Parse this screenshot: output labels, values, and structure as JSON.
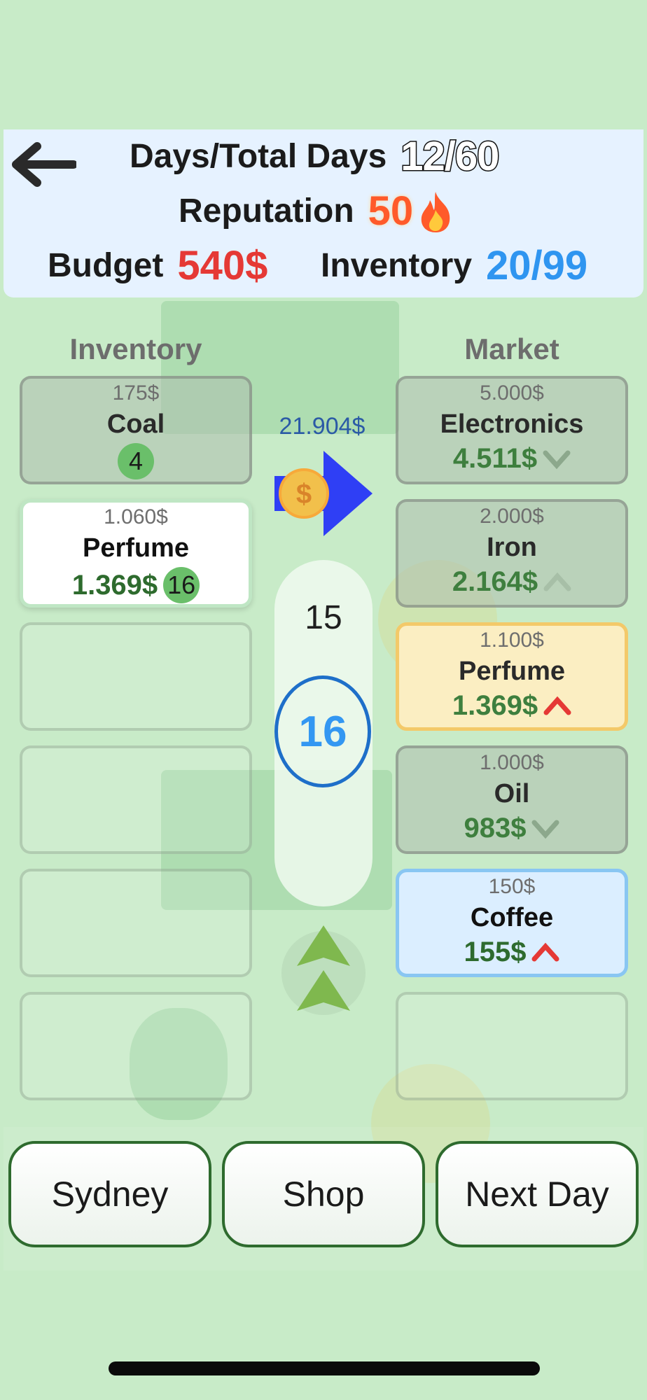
{
  "header": {
    "days_label": "Days/Total Days",
    "days_value": "12/60",
    "reputation_label": "Reputation",
    "reputation_value": "50",
    "reputation_icon": "fire-icon",
    "budget_label": "Budget",
    "budget_value": "540$",
    "inventory_label": "Inventory",
    "inventory_value": "20/99"
  },
  "inventory": {
    "title": "Inventory",
    "slots": [
      {
        "price": "175$",
        "name": "Coal",
        "qty": "4"
      },
      {
        "price": "1.060$",
        "name": "Perfume",
        "sell": "1.369$",
        "qty": "16"
      }
    ]
  },
  "market": {
    "title": "Market",
    "items": [
      {
        "base": "5.000$",
        "name": "Electronics",
        "current": "4.511$",
        "trend": "down"
      },
      {
        "base": "2.000$",
        "name": "Iron",
        "current": "2.164$",
        "trend": "up-faded"
      },
      {
        "base": "1.100$",
        "name": "Perfume",
        "current": "1.369$",
        "trend": "up"
      },
      {
        "base": "1.000$",
        "name": "Oil",
        "current": "983$",
        "trend": "down"
      },
      {
        "base": "150$",
        "name": "Coffee",
        "current": "155$",
        "trend": "up"
      }
    ]
  },
  "trade": {
    "total": "21.904$",
    "prev_qty": "15",
    "current_qty": "16"
  },
  "buttons": {
    "city": "Sydney",
    "shop": "Shop",
    "next_day": "Next Day"
  },
  "colors": {
    "background": "#c8ebc8",
    "budget": "#e53935",
    "inventory": "#2f95f0",
    "reputation": "#ff5a2a",
    "button_border": "#2e6b2e"
  }
}
